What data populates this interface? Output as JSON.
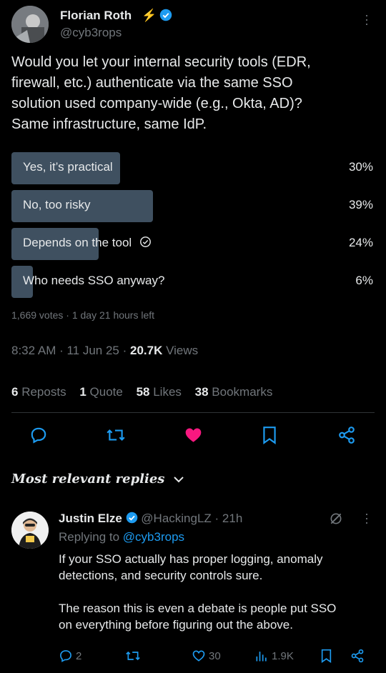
{
  "tweet": {
    "author_name": "Florian Roth",
    "author_handle": "@cyb3rops",
    "text_lines": [
      "Would you let your internal security tools (EDR,",
      "firewall, etc.) authenticate via the same SSO",
      "solution used company-wide (e.g., Okta, AD)?",
      "Same infrastructure, same IdP."
    ],
    "poll": {
      "options": [
        {
          "label": "Yes, it’s practical",
          "percent": "30%",
          "fraction": 0.3
        },
        {
          "label": "No, too risky",
          "percent": "39%",
          "fraction": 0.39
        },
        {
          "label": "Depends on the tool",
          "percent": "24%",
          "fraction": 0.24
        },
        {
          "label": "Who needs SSO anyway?",
          "percent": "6%",
          "fraction": 0.06
        }
      ],
      "votes": "1,669 votes",
      "time_left": "1 day 21 hours left"
    },
    "timestamp": "8:32 AM · 11 Jun 25",
    "views_count": "20.7K",
    "views_label": "Views",
    "stats": {
      "reposts_count": "6",
      "reposts_label": "Reposts",
      "quotes_count": "1",
      "quotes_label": "Quote",
      "likes_count": "58",
      "likes_label": "Likes",
      "bookmarks_count": "38",
      "bookmarks_label": "Bookmarks"
    }
  },
  "replies_header": "Most relevant replies",
  "reply": {
    "author_name": "Justin Elze",
    "author_handle": "@HackingLZ",
    "time": "· 21h",
    "replying_prefix": "Replying to",
    "replying_to": "@cyb3rops",
    "text_lines_1": [
      "If your SSO actually has proper logging, anomaly",
      "detections, and security controls sure."
    ],
    "text_lines_2": [
      "The reason this is even a debate is people put SSO",
      "on everything before figuring out the above."
    ],
    "comments": "2",
    "likes": "30",
    "views": "1.9K"
  },
  "colors": {
    "accent": "#1d9bf0",
    "like": "#f91880",
    "poll_bar": "#3f5060"
  }
}
